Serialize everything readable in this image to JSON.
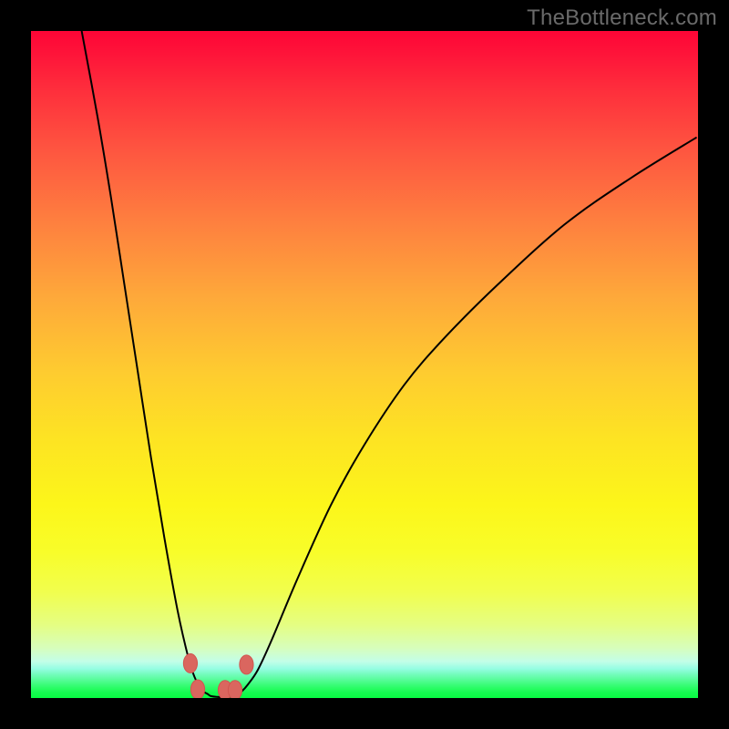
{
  "watermark": "TheBottleneck.com",
  "colors": {
    "frame": "#000000",
    "curve_stroke": "#000000",
    "marker_fill": "#da665f",
    "marker_stroke": "#d1554f"
  },
  "chart_data": {
    "type": "line",
    "title": "",
    "xlabel": "",
    "ylabel": "",
    "xlim": [
      0,
      100
    ],
    "ylim": [
      0,
      100
    ],
    "grid": false,
    "legend": false,
    "series": [
      {
        "name": "curve-left",
        "x": [
          7.6,
          10,
          12,
          14,
          16,
          18,
          20,
          22,
          23.6,
          24.5,
          25.2,
          25.8,
          26.5
        ],
        "y": [
          100,
          87,
          75,
          62,
          49,
          36,
          24,
          13,
          6,
          3.2,
          1.8,
          1.0,
          0.6
        ]
      },
      {
        "name": "curve-right",
        "x": [
          31,
          31.6,
          32.5,
          34,
          36,
          40,
          45,
          50,
          56,
          62,
          70,
          80,
          90,
          99.7
        ],
        "y": [
          0.6,
          1.0,
          2.0,
          4.2,
          8.5,
          18,
          29,
          38,
          47,
          54,
          62,
          71,
          78,
          84
        ]
      }
    ],
    "markers": [
      {
        "x": 23.9,
        "y": 5.2
      },
      {
        "x": 25.0,
        "y": 1.3
      },
      {
        "x": 29.1,
        "y": 1.2
      },
      {
        "x": 30.6,
        "y": 1.2
      },
      {
        "x": 32.3,
        "y": 5.0
      }
    ]
  }
}
